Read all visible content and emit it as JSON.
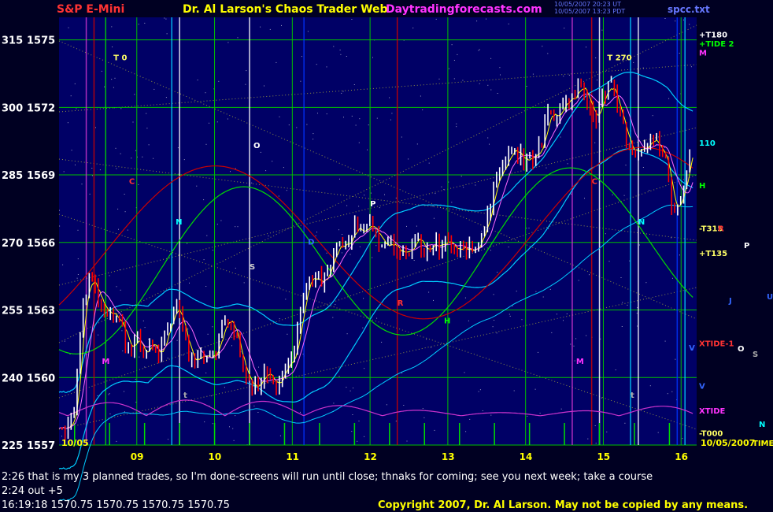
{
  "header": {
    "instrument": "S&P E-Mini",
    "site_title": "Dr. Al Larson's Chaos Trader Web",
    "site_url": "Daytradingforecasts.com",
    "timestamp_line1": "10/05/2007 20:23 UT",
    "timestamp_line2": "10/05/2007 13:23 PDT",
    "file_name": "spcc.txt"
  },
  "footer": {
    "comment_line": "2:26 that is my 3 planned trades, so I'm done-screens will run until close; thnaks for coming; see you next week; take a course",
    "trade_line": "2:24 out +5",
    "quote_line": "16:19:18  1570.75 1570.75 1570.75 1570.75",
    "copyright": "Copyright 2007, Dr. Al Larson. May not be copied by any means."
  },
  "colors": {
    "background": "#000022",
    "grid": "#00c000",
    "up_bar": "#ffffff",
    "down_bar": "#ff0000",
    "ma_fast": "#ffff00",
    "ma_mid": "#ff66ff",
    "band": "#00ccff",
    "green_flux": "#00dd00",
    "red_flux": "#cc0000",
    "xtide": "#cc33cc"
  },
  "chart_data": {
    "type": "candlestick",
    "title": "S&P E-Mini",
    "ylim": [
      1557,
      1576
    ],
    "yticks": [
      {
        "value": 1557,
        "left": "225",
        "right": "1557"
      },
      {
        "value": 1560,
        "left": "240",
        "right": "1560"
      },
      {
        "value": 1563,
        "left": "255",
        "right": "1563"
      },
      {
        "value": 1566,
        "left": "270",
        "right": "1566"
      },
      {
        "value": 1569,
        "left": "285",
        "right": "1569"
      },
      {
        "value": 1572,
        "left": "300",
        "right": "1572"
      },
      {
        "value": 1575,
        "left": "315",
        "right": "1575"
      }
    ],
    "xlim": [
      8.0,
      16.2
    ],
    "xticks": [
      "09",
      "10",
      "11",
      "12",
      "13",
      "14",
      "15",
      "16"
    ],
    "x_tick_values": [
      9,
      10,
      11,
      12,
      13,
      14,
      15,
      16
    ],
    "start_label": "10/05",
    "end_label": "10/05/2007",
    "price_path": [
      [
        8.0,
        1558.0
      ],
      [
        8.1,
        1557.8
      ],
      [
        8.2,
        1558.4
      ],
      [
        8.3,
        1563.2
      ],
      [
        8.4,
        1564.4
      ],
      [
        8.5,
        1563.6
      ],
      [
        8.6,
        1563.0
      ],
      [
        8.7,
        1562.7
      ],
      [
        8.8,
        1562.2
      ],
      [
        8.9,
        1561.2
      ],
      [
        9.0,
        1561.8
      ],
      [
        9.1,
        1561.0
      ],
      [
        9.2,
        1561.6
      ],
      [
        9.3,
        1561.0
      ],
      [
        9.4,
        1562.4
      ],
      [
        9.5,
        1563.2
      ],
      [
        9.6,
        1562.0
      ],
      [
        9.7,
        1560.6
      ],
      [
        9.8,
        1561.0
      ],
      [
        9.9,
        1560.8
      ],
      [
        10.0,
        1561.0
      ],
      [
        10.1,
        1562.2
      ],
      [
        10.2,
        1562.6
      ],
      [
        10.3,
        1561.4
      ],
      [
        10.4,
        1560.0
      ],
      [
        10.5,
        1559.6
      ],
      [
        10.6,
        1560.0
      ],
      [
        10.7,
        1560.4
      ],
      [
        10.8,
        1559.6
      ],
      [
        10.9,
        1560.4
      ],
      [
        11.0,
        1560.6
      ],
      [
        11.1,
        1562.6
      ],
      [
        11.2,
        1564.4
      ],
      [
        11.3,
        1564.6
      ],
      [
        11.4,
        1564.2
      ],
      [
        11.5,
        1565.2
      ],
      [
        11.6,
        1566.0
      ],
      [
        11.7,
        1565.8
      ],
      [
        11.8,
        1566.6
      ],
      [
        11.9,
        1566.4
      ],
      [
        12.0,
        1566.8
      ],
      [
        12.1,
        1566.2
      ],
      [
        12.2,
        1565.8
      ],
      [
        12.3,
        1566.0
      ],
      [
        12.4,
        1565.6
      ],
      [
        12.5,
        1565.4
      ],
      [
        12.6,
        1566.2
      ],
      [
        12.7,
        1565.6
      ],
      [
        12.8,
        1566.0
      ],
      [
        12.9,
        1565.8
      ],
      [
        13.0,
        1566.2
      ],
      [
        13.1,
        1565.6
      ],
      [
        13.2,
        1566.0
      ],
      [
        13.3,
        1565.6
      ],
      [
        13.4,
        1566.0
      ],
      [
        13.5,
        1567.0
      ],
      [
        13.6,
        1568.6
      ],
      [
        13.7,
        1569.6
      ],
      [
        13.8,
        1569.8
      ],
      [
        13.9,
        1570.0
      ],
      [
        14.0,
        1569.6
      ],
      [
        14.1,
        1569.8
      ],
      [
        14.2,
        1570.4
      ],
      [
        14.3,
        1572.0
      ],
      [
        14.4,
        1571.4
      ],
      [
        14.5,
        1572.4
      ],
      [
        14.6,
        1572.4
      ],
      [
        14.7,
        1573.0
      ],
      [
        14.8,
        1572.2
      ],
      [
        14.9,
        1571.6
      ],
      [
        15.0,
        1572.6
      ],
      [
        15.1,
        1573.0
      ],
      [
        15.2,
        1571.8
      ],
      [
        15.3,
        1570.6
      ],
      [
        15.4,
        1570.0
      ],
      [
        15.5,
        1570.2
      ],
      [
        15.6,
        1570.6
      ],
      [
        15.7,
        1570.4
      ],
      [
        15.8,
        1569.6
      ],
      [
        15.9,
        1567.2
      ],
      [
        16.0,
        1568.2
      ],
      [
        16.1,
        1569.6
      ],
      [
        16.15,
        1570.75
      ]
    ],
    "series": [
      {
        "name": "fast-ma",
        "color": "#ffff00"
      },
      {
        "name": "mid-ma",
        "color": "#ff66ff"
      },
      {
        "name": "upper-band",
        "color": "#00ccff"
      },
      {
        "name": "lower-band",
        "color": "#00ccff"
      },
      {
        "name": "green-flux",
        "color": "#00dd00"
      },
      {
        "name": "red-flux",
        "color": "#cc0000"
      },
      {
        "name": "xtide",
        "color": "#cc33cc"
      }
    ],
    "vertical_markers": [
      {
        "x": 8.35,
        "color": "#cc33cc"
      },
      {
        "x": 8.45,
        "color": "#cc0000"
      },
      {
        "x": 8.6,
        "color": "#00dd00"
      },
      {
        "x": 9.45,
        "color": "#00ccff"
      },
      {
        "x": 9.55,
        "color": "#ffffff"
      },
      {
        "x": 10.45,
        "color": "#ffffff"
      },
      {
        "x": 11.15,
        "color": "#0033ff"
      },
      {
        "x": 12.35,
        "color": "#cc0000"
      },
      {
        "x": 14.6,
        "color": "#cc33cc"
      },
      {
        "x": 14.85,
        "color": "#cc0000"
      },
      {
        "x": 14.95,
        "color": "#ffffff"
      },
      {
        "x": 15.35,
        "color": "#00ccff"
      },
      {
        "x": 15.45,
        "color": "#ffffff"
      },
      {
        "x": 15.95,
        "color": "#0033ff"
      },
      {
        "x": 16.05,
        "color": "#00ccff"
      }
    ],
    "chart_markers": [
      {
        "text": "T 0",
        "x": 8.7,
        "y": 1574.1,
        "color": "#ffff66"
      },
      {
        "text": "C",
        "x": 8.9,
        "y": 1568.6,
        "color": "#ff3333"
      },
      {
        "text": "N",
        "x": 9.5,
        "y": 1566.8,
        "color": "#00ffff"
      },
      {
        "text": "O",
        "x": 10.5,
        "y": 1570.2,
        "color": "#ffffff"
      },
      {
        "text": "P",
        "x": 12.0,
        "y": 1567.6,
        "color": "#ffffff"
      },
      {
        "text": "S",
        "x": 10.45,
        "y": 1564.8,
        "color": "#cccccc"
      },
      {
        "text": "D",
        "x": 11.2,
        "y": 1565.9,
        "color": "#3366ff"
      },
      {
        "text": "R",
        "x": 12.35,
        "y": 1563.2,
        "color": "#ff3333"
      },
      {
        "text": "H",
        "x": 12.95,
        "y": 1562.4,
        "color": "#00ff00"
      },
      {
        "text": "M",
        "x": 8.55,
        "y": 1560.6,
        "color": "#ff33ff"
      },
      {
        "text": "t",
        "x": 9.6,
        "y": 1559.1,
        "color": "#aaaaaa"
      },
      {
        "text": "T 270",
        "x": 15.05,
        "y": 1574.1,
        "color": "#ffff66"
      },
      {
        "text": "C",
        "x": 14.85,
        "y": 1568.6,
        "color": "#ff3333"
      },
      {
        "text": "N",
        "x": 15.45,
        "y": 1566.8,
        "color": "#00ffff"
      },
      {
        "text": "M",
        "x": 14.65,
        "y": 1560.6,
        "color": "#ff33ff"
      },
      {
        "text": "t",
        "x": 15.35,
        "y": 1559.1,
        "color": "#aaaaaa"
      },
      {
        "text": "V",
        "x": 16.1,
        "y": 1561.2,
        "color": "#3366ff"
      }
    ],
    "right_labels": [
      {
        "text": "+T180",
        "y": 1575.1,
        "color": "#ffffff"
      },
      {
        "text": "+TIDE 2",
        "y": 1574.7,
        "color": "#00ff00"
      },
      {
        "text": "M",
        "y": 1574.3,
        "color": "#ff33ff"
      },
      {
        "text": "110",
        "y": 1570.3,
        "color": "#00ffff"
      },
      {
        "text": "H",
        "y": 1568.4,
        "color": "#00ff00"
      },
      {
        "text": "-T315",
        "y": 1566.5,
        "color": "#ffff66"
      },
      {
        "text": "R",
        "y": 1566.5,
        "color": "#ff3333"
      },
      {
        "text": "+T135",
        "y": 1565.4,
        "color": "#ffff66"
      },
      {
        "text": "XTIDE-1",
        "y": 1561.4,
        "color": "#ff3333"
      },
      {
        "text": "V",
        "y": 1559.5,
        "color": "#3366ff"
      },
      {
        "text": "XTIDE",
        "y": 1558.4,
        "color": "#ff33ff"
      },
      {
        "text": "-T000",
        "y": 1557.4,
        "color": "#ffff66"
      }
    ],
    "side_markers": [
      {
        "text": "P",
        "x": 945,
        "y": 315,
        "color": "#ffffff"
      },
      {
        "text": "J",
        "x": 926,
        "y": 385,
        "color": "#3366ff"
      },
      {
        "text": "U",
        "x": 974,
        "y": 380,
        "color": "#3366ff"
      },
      {
        "text": "O",
        "x": 937,
        "y": 446,
        "color": "#ffffff"
      },
      {
        "text": "S",
        "x": 956,
        "y": 453,
        "color": "#aaaaaa"
      },
      {
        "text": "N",
        "x": 964,
        "y": 542,
        "color": "#00ffff"
      },
      {
        "text": "TIME",
        "x": 956,
        "y": 566,
        "color": "#ffff00"
      }
    ]
  }
}
